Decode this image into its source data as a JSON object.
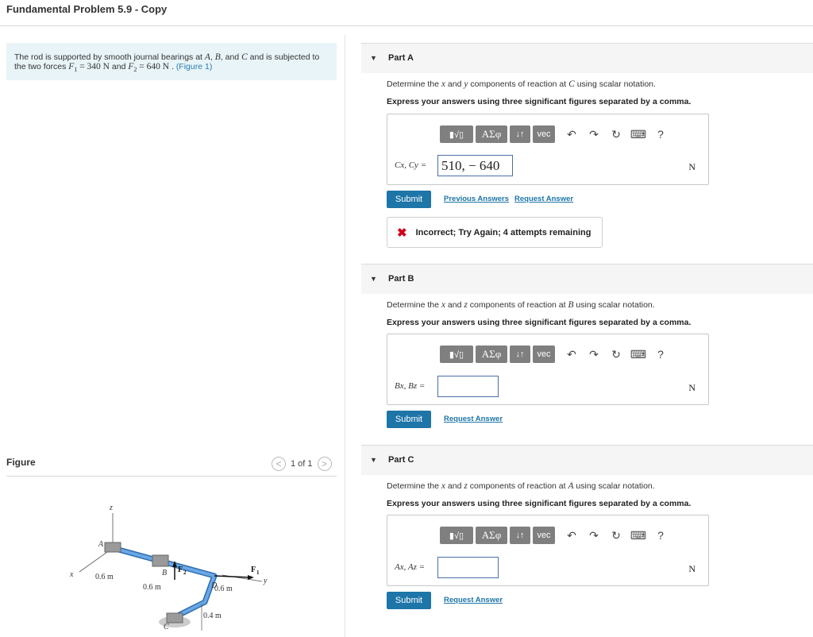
{
  "page": {
    "title": "Fundamental Problem 5.9 - Copy"
  },
  "problem": {
    "text_1": "The rod is supported by smooth journal bearings at ",
    "A": "A",
    "sep1": ", ",
    "B": "B",
    "sep2": ", and ",
    "C": "C",
    "text_2": " and is subjected to the two forces ",
    "F1_sym": "F",
    "F1_sub": "1",
    "F1_val": " = 340  N",
    "and": " and ",
    "F2_sym": "F",
    "F2_sub": "2",
    "F2_val": " = 640  N",
    "dot": " . ",
    "figure_link": "(Figure 1)"
  },
  "figure": {
    "label": "Figure",
    "pager": "1 of 1",
    "prev": "<",
    "next": ">",
    "labels": {
      "z": "z",
      "x": "x",
      "y": "y",
      "A": "A",
      "B": "B",
      "C": "C",
      "D": "D",
      "F1": "F",
      "F1sub": "1",
      "F2": "F",
      "F2sub": "2",
      "d1": "0.6 m",
      "d2": "0.6 m",
      "d3": "0.6 m",
      "d4": "0.4 m"
    }
  },
  "toolbar": {
    "templates": "▮√▯",
    "greek": "ΑΣφ",
    "arrows": "↓↑",
    "vec": "vec",
    "undo": "↶",
    "redo": "↷",
    "reset": "↻",
    "keyboard": "⌨",
    "help": "?"
  },
  "parts": [
    {
      "title": "Part A",
      "instruction_pre": "Determine the ",
      "v1": "x",
      "mid": " and ",
      "v2": "y",
      "instruction_post": " components of reaction at ",
      "point": "C",
      "instruction_end": " using scalar notation.",
      "express": "Express your answers using three significant figures separated by a comma.",
      "var_label": "Cx, Cy =",
      "answer": "510, − 640",
      "unit": "N",
      "submit": "Submit",
      "prev_answers": "Previous Answers",
      "request_answer": "Request Answer",
      "feedback_icon": "✖",
      "feedback": "Incorrect; Try Again; 4 attempts remaining"
    },
    {
      "title": "Part B",
      "instruction_pre": "Determine the ",
      "v1": "x",
      "mid": " and ",
      "v2": "z",
      "instruction_post": " components of reaction at ",
      "point": "B",
      "instruction_end": " using scalar notation.",
      "express": "Express your answers using three significant figures separated by a comma.",
      "var_label": "Bx, Bz =",
      "answer": "",
      "unit": "N",
      "submit": "Submit",
      "request_answer": "Request Answer"
    },
    {
      "title": "Part C",
      "instruction_pre": "Determine the ",
      "v1": "x",
      "mid": " and ",
      "v2": "z",
      "instruction_post": " components of reaction at ",
      "point": "A",
      "instruction_end": " using scalar notation.",
      "express": "Express your answers using three significant figures separated by a comma.",
      "var_label": "Ax, Az =",
      "answer": "",
      "unit": "N",
      "submit": "Submit",
      "request_answer": "Request Answer"
    }
  ],
  "colors": {
    "accent": "#1d75a8",
    "error": "#d0021b",
    "rod": "#4a90d9"
  }
}
